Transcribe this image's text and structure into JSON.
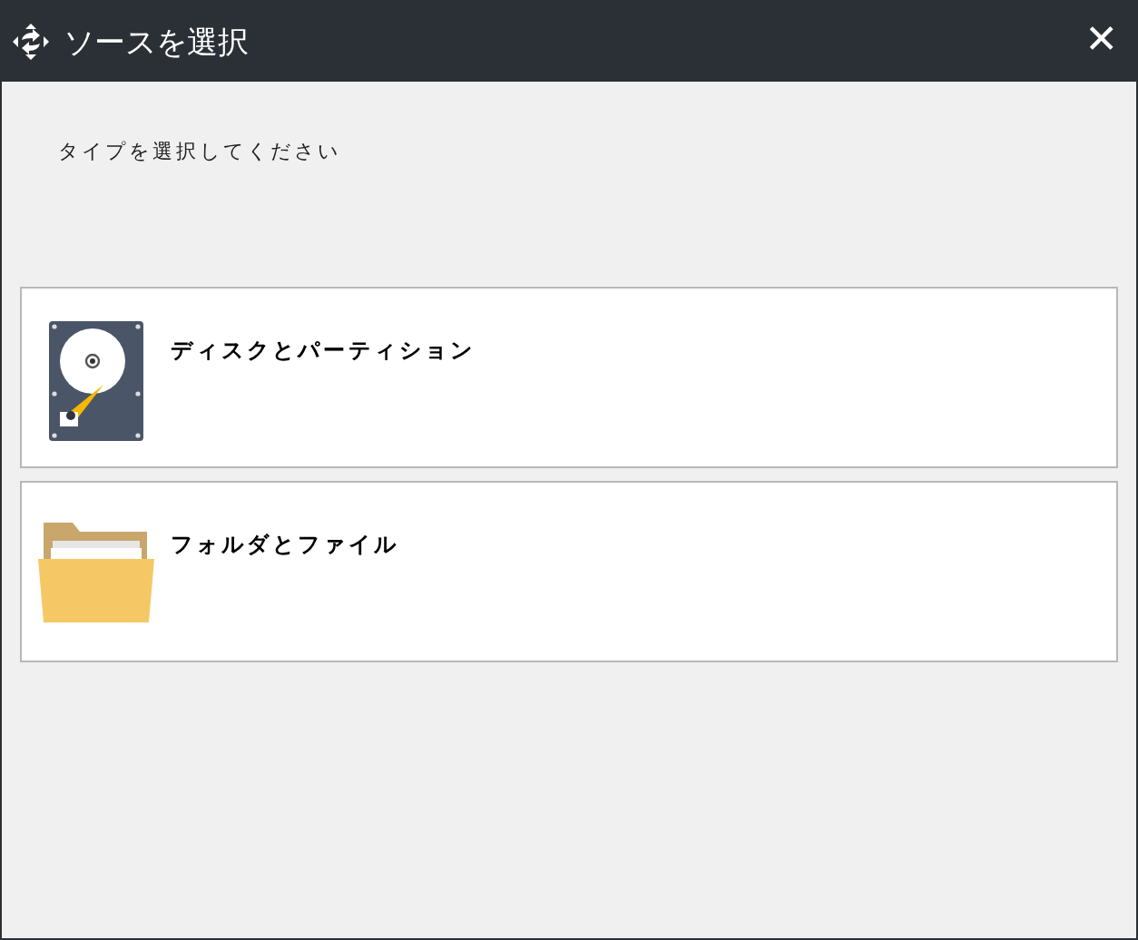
{
  "window": {
    "title": "ソースを選択",
    "close": "✕"
  },
  "prompt": "タイプを選択してください",
  "options": [
    {
      "kind": "disk",
      "label": "ディスクとパーティション"
    },
    {
      "kind": "folder",
      "label": "フォルダとファイル"
    }
  ]
}
